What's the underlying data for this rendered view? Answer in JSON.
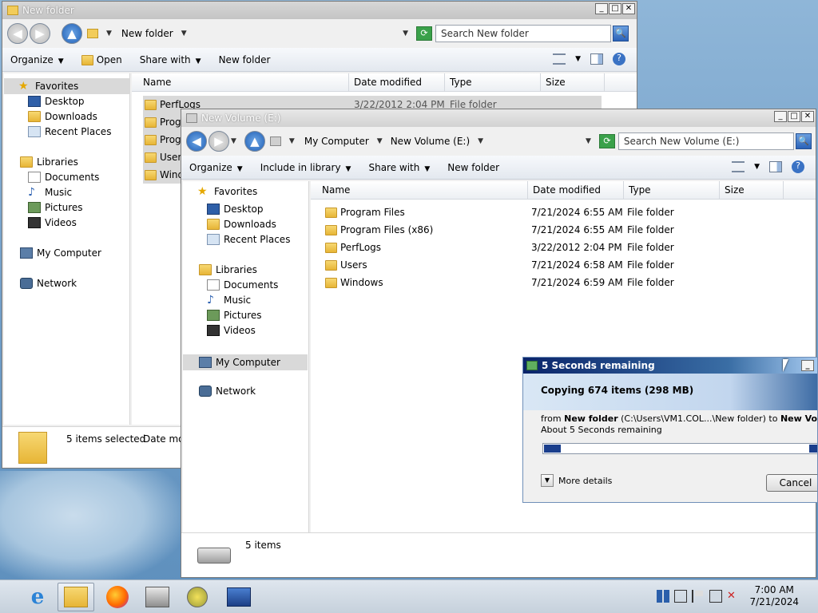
{
  "back_window": {
    "title": "New folder",
    "crumbs": [
      "New folder"
    ],
    "search_placeholder": "Search New folder",
    "commands": [
      "Organize",
      "Open",
      "Share with",
      "New folder"
    ],
    "columns": [
      "Name",
      "Date modified",
      "Type",
      "Size"
    ],
    "nav": {
      "favorites": "Favorites",
      "fav_items": [
        "Desktop",
        "Downloads",
        "Recent Places"
      ],
      "libraries": "Libraries",
      "lib_items": [
        "Documents",
        "Music",
        "Pictures",
        "Videos"
      ],
      "computer": "My Computer",
      "network": "Network"
    },
    "rows": [
      {
        "name": "PerfLogs",
        "date": "3/22/2012 2:04 PM",
        "type": "File folder"
      },
      {
        "name": "Progr",
        "date": "",
        "type": ""
      },
      {
        "name": "Progr",
        "date": "",
        "type": ""
      },
      {
        "name": "Users",
        "date": "",
        "type": ""
      },
      {
        "name": "Windo",
        "date": "",
        "type": ""
      }
    ],
    "status": "5 items selected",
    "status_extra": "Date mod"
  },
  "front_window": {
    "title": "New Volume (E:)",
    "crumbs": [
      "My Computer",
      "New Volume (E:)"
    ],
    "search_placeholder": "Search New Volume (E:)",
    "commands": [
      "Organize",
      "Include in library",
      "Share with",
      "New folder"
    ],
    "columns": [
      "Name",
      "Date modified",
      "Type",
      "Size"
    ],
    "nav": {
      "favorites": "Favorites",
      "fav_items": [
        "Desktop",
        "Downloads",
        "Recent Places"
      ],
      "libraries": "Libraries",
      "lib_items": [
        "Documents",
        "Music",
        "Pictures",
        "Videos"
      ],
      "computer": "My Computer",
      "network": "Network"
    },
    "rows": [
      {
        "name": "Program Files",
        "date": "7/21/2024 6:55 AM",
        "type": "File folder"
      },
      {
        "name": "Program Files (x86)",
        "date": "7/21/2024 6:55 AM",
        "type": "File folder"
      },
      {
        "name": "PerfLogs",
        "date": "3/22/2012 2:04 PM",
        "type": "File folder"
      },
      {
        "name": "Users",
        "date": "7/21/2024 6:58 AM",
        "type": "File folder"
      },
      {
        "name": "Windows",
        "date": "7/21/2024 6:59 AM",
        "type": "File folder"
      }
    ],
    "status": "5 items"
  },
  "copy_dialog": {
    "title": "5 Seconds remaining",
    "heading": "Copying 674 items (298 MB)",
    "from_label": "from",
    "from_name": "New folder",
    "from_path": "(C:\\Users\\VM1.COL...\\New folder)",
    "to_label": "to",
    "to_name": "New Volume (E",
    "remaining": "About 5 Seconds remaining",
    "more_details": "More details",
    "cancel": "Cancel",
    "progress": 0.06
  },
  "taskbar": {
    "time": "7:00 AM",
    "date": "7/21/2024"
  },
  "colors": {
    "accent": "#1a3e8c",
    "folder": "#e7b536",
    "selection": "#d9d9d9"
  }
}
